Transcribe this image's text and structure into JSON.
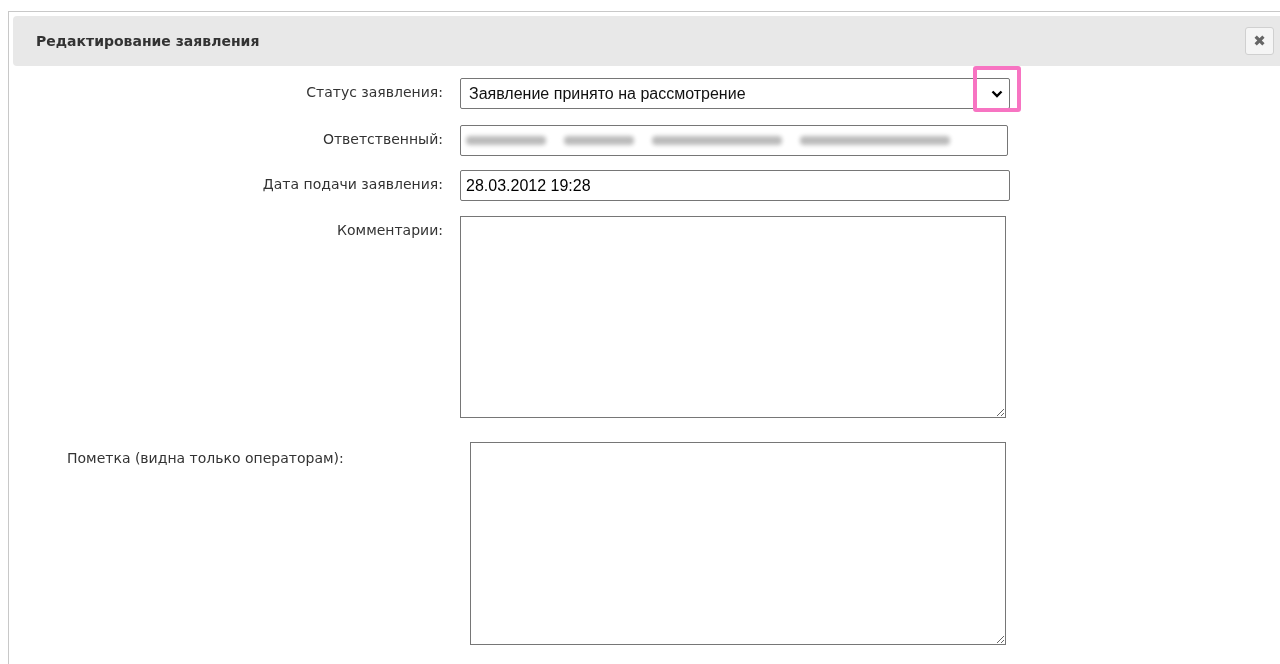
{
  "dialog": {
    "title": "Редактирование заявления",
    "close_label": "✖"
  },
  "fields": [
    {
      "kind": "select",
      "label": "Статус заявления:",
      "value": "Заявление принято на рассмотрение",
      "highlighted": true
    },
    {
      "kind": "redacted",
      "label": "Ответственный:"
    },
    {
      "kind": "text",
      "label": "Дата подачи заявления:",
      "value": "28.03.2012 19:28"
    },
    {
      "kind": "textarea",
      "label": "Комментарии:"
    },
    {
      "kind": "note",
      "label": "Пометка (видна только операторам):"
    }
  ]
}
